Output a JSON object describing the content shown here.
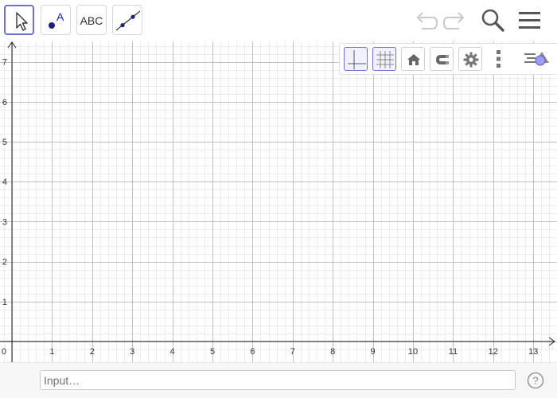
{
  "toolbar": {
    "tools": [
      {
        "name": "move-tool",
        "icon": "arrow-cursor-icon",
        "selected": true
      },
      {
        "name": "point-tool",
        "icon": "point-icon",
        "label": "A"
      },
      {
        "name": "text-tool",
        "icon": "text-icon",
        "label": "ABC"
      },
      {
        "name": "line-tool",
        "icon": "line-icon"
      }
    ],
    "actions": [
      "undo-icon",
      "redo-icon",
      "search-icon",
      "menu-icon"
    ]
  },
  "stylebar": {
    "buttons": [
      "axes-icon",
      "grid-icon",
      "home-icon",
      "magnet-icon",
      "gear-icon",
      "more-vert-icon",
      "view-toggle-icon"
    ]
  },
  "graphics": {
    "x_ticks": [
      "0",
      "1",
      "2",
      "3",
      "4",
      "5",
      "6",
      "7",
      "8",
      "9",
      "10",
      "11",
      "12",
      "13"
    ],
    "y_ticks": [
      "1",
      "2",
      "3",
      "4",
      "5",
      "6",
      "7"
    ],
    "grid": true,
    "axes": true
  },
  "input_bar": {
    "placeholder": "Input…",
    "help": "?"
  },
  "colors": {
    "accent": "#6e6ed8",
    "point": "#1565c0",
    "grid_major": "#c0c0c0",
    "grid_minor": "#ececec",
    "icon": "#555555",
    "icon_disabled": "#c8c8c8"
  }
}
